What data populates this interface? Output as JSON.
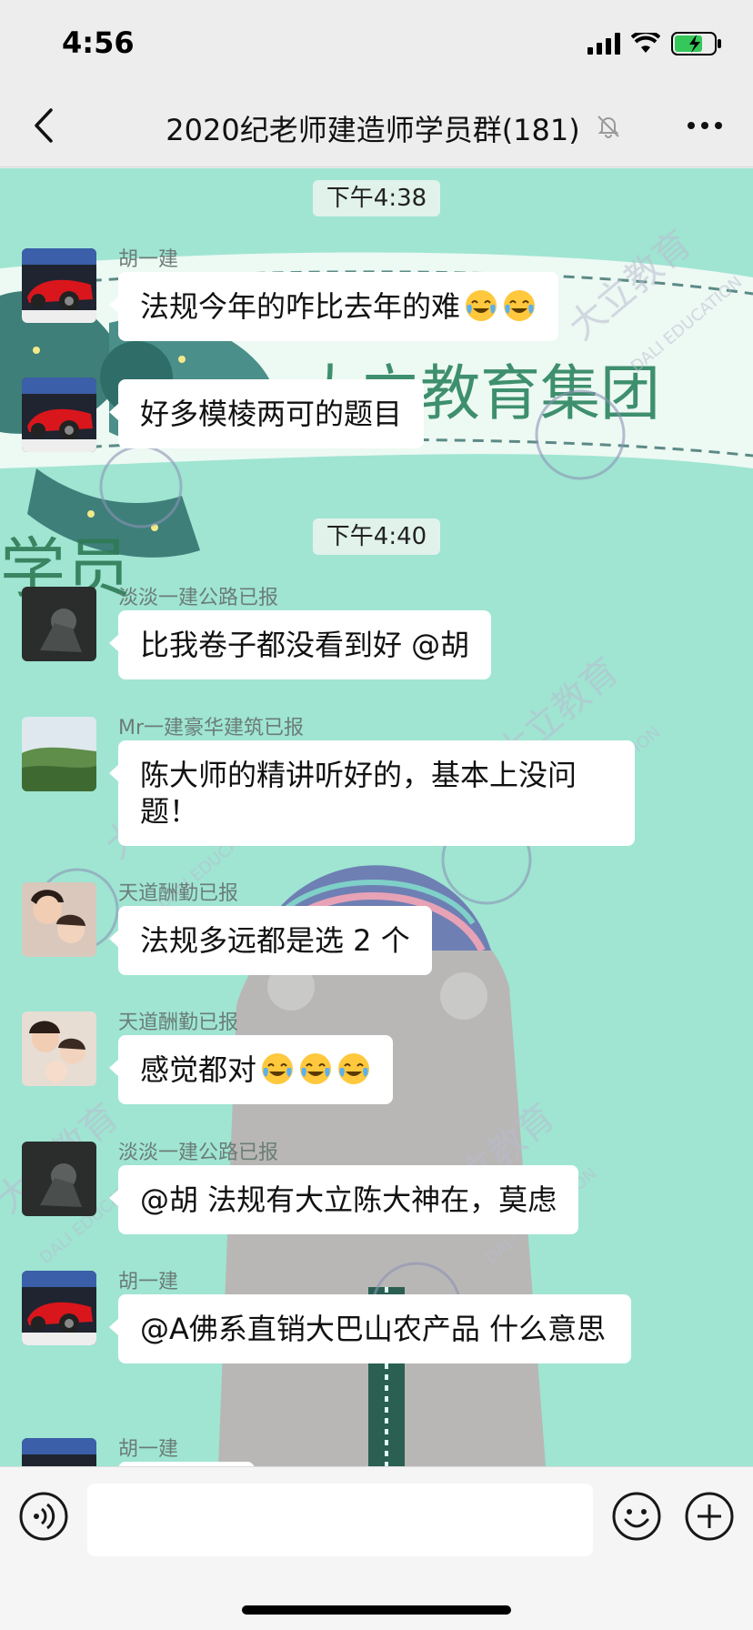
{
  "status_bar": {
    "time": "4:56"
  },
  "nav": {
    "title": "2020纪老师建造师学员群(181)"
  },
  "timestamps": [
    "下午4:38",
    "下午4:40"
  ],
  "watermark": {
    "logo_text": "大立教育",
    "logo_en": "DALI EDUCATION",
    "banner_text": "大立教育集团",
    "banner_text2": "学员"
  },
  "messages": [
    {
      "sender": "胡一建",
      "text": "法规今年的咋比去年的难",
      "emoji": [
        "crying-laughing-emoji",
        "crying-laughing-emoji"
      ]
    },
    {
      "sender": "",
      "text": "好多模棱两可的题目"
    },
    {
      "sender": "淡淡一建公路已报",
      "text": "比我卷子都没看到好 @胡"
    },
    {
      "sender": "Mr一建豪华建筑已报",
      "text": "陈大师的精讲听好的，基本上没问题！"
    },
    {
      "sender": "天道酬勤已报",
      "text": "法规多远都是选 2 个"
    },
    {
      "sender": "天道酬勤已报",
      "text": "感觉都对",
      "emoji": [
        "crying-laughing-emoji",
        "crying-laughing-emoji",
        "crying-laughing-emoji"
      ]
    },
    {
      "sender": "淡淡一建公路已报",
      "text": "@胡 法规有大立陈大神在，莫虑"
    },
    {
      "sender": "胡一建",
      "text": "@A佛系直销大巴山农产品 什么意思"
    },
    {
      "sender": "胡一建",
      "text": ""
    }
  ],
  "input": {
    "placeholder": ""
  }
}
